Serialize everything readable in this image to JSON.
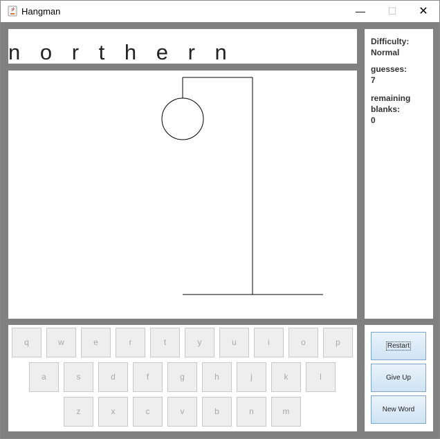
{
  "window": {
    "title": "Hangman",
    "minimize": "—",
    "maximize": "☐",
    "close": "✕"
  },
  "word": "n o r t h e r n",
  "status": {
    "difficulty_label": "Difficulty:",
    "difficulty_value": "Normal",
    "guesses_label": "guesses:",
    "guesses_value": "7",
    "remaining_label1": "remaining",
    "remaining_label2": "blanks:",
    "remaining_value": "0"
  },
  "keyboard": {
    "row1": [
      "q",
      "w",
      "e",
      "r",
      "t",
      "y",
      "u",
      "i",
      "o",
      "p"
    ],
    "row2": [
      "a",
      "s",
      "d",
      "f",
      "g",
      "h",
      "j",
      "k",
      "l"
    ],
    "row3": [
      "z",
      "x",
      "c",
      "v",
      "b",
      "n",
      "m"
    ],
    "enabled": false
  },
  "actions": {
    "restart": "Restart",
    "give_up": "Give Up",
    "new_word": "New Word"
  },
  "colors": {
    "frame": "#808080",
    "button_gradient_top": "#eaf3fb",
    "button_gradient_bottom": "#cfe3f3",
    "button_border": "#7aa6cf"
  }
}
